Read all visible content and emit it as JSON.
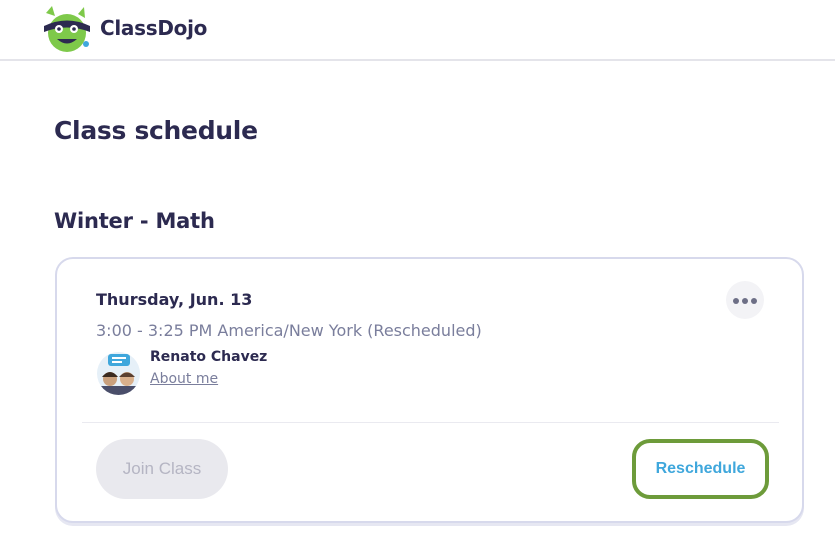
{
  "header": {
    "brand": "ClassDojo"
  },
  "page": {
    "title": "Class schedule"
  },
  "section": {
    "title": "Winter - Math"
  },
  "session": {
    "date": "Thursday, Jun. 13",
    "time": "3:00 - 3:25 PM America/New York (Rescheduled)",
    "teacher": {
      "name": "Renato Chavez",
      "about_label": "About me"
    },
    "actions": {
      "join_label": "Join Class",
      "reschedule_label": "Reschedule"
    }
  },
  "colors": {
    "text_primary": "#2c2a50",
    "text_secondary": "#7a7e9c",
    "link_blue": "#3fa7dc",
    "focus_green": "#6d9b3a",
    "disabled_bg": "#e9e9ee"
  },
  "icons": {
    "logo": "classdojo-monster-logo",
    "more": "more-horizontal-icon"
  }
}
